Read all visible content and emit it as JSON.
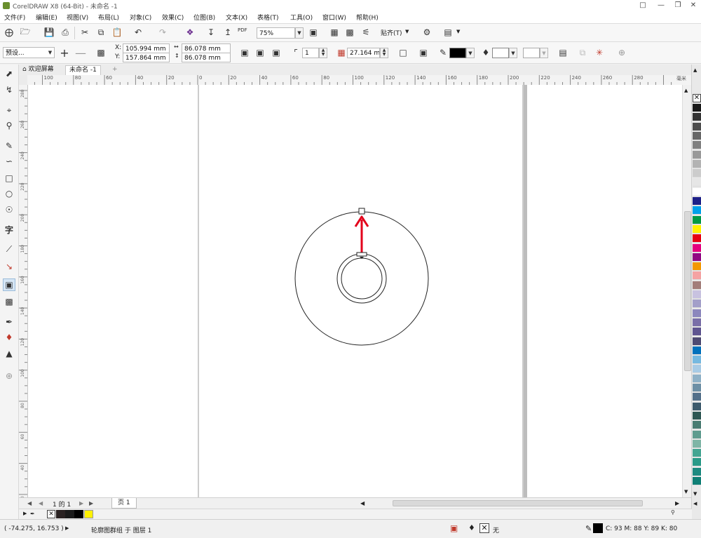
{
  "window": {
    "title": "CorelDRAW X8 (64-Bit) - 未命名 -1"
  },
  "menu": [
    "文件(F)",
    "编辑(E)",
    "视图(V)",
    "布局(L)",
    "对象(C)",
    "效果(C)",
    "位图(B)",
    "文本(X)",
    "表格(T)",
    "工具(O)",
    "窗口(W)",
    "帮助(H)"
  ],
  "standard_toolbar": {
    "zoom_value": "75%",
    "snap_label": "贴齐(T)",
    "pdf_label": "PDF"
  },
  "property_bar": {
    "preset_value": "预设...",
    "x_label": "X:",
    "x_value": "105.994 mm",
    "y_label": "Y:",
    "y_value": "157.864 mm",
    "width_value": "86.078 mm",
    "height_value": "86.078 mm",
    "steps_value": "1",
    "offset_value": "27.164 mm"
  },
  "doc_tabs": {
    "welcome": "欢迎屏幕",
    "active": "未命名 -1"
  },
  "ruler": {
    "h_labels": [
      "100",
      "80",
      "60",
      "40",
      "20",
      "0",
      "20",
      "40",
      "60",
      "80",
      "100",
      "120",
      "140",
      "160",
      "180",
      "200",
      "220",
      "240",
      "260",
      "280"
    ],
    "h_unit": "毫米",
    "v_labels": [
      "280",
      "260",
      "240",
      "220",
      "200",
      "180",
      "160",
      "140",
      "120",
      "100",
      "80",
      "60",
      "40",
      "20"
    ]
  },
  "page_nav": {
    "page_counter": "1 的 1",
    "page_tab": "页 1"
  },
  "status": {
    "cursor_coords": "( -74.275, 16.753 )",
    "selection_info": "轮廓图群组 于 图层 1",
    "fill_label": "无",
    "outline_color": "C: 93 M: 88 Y: 89 K: 80"
  },
  "colors": {
    "accent": "#e3001b",
    "palette": [
      "#1a1a1a",
      "#333333",
      "#4d4d4d",
      "#666666",
      "#808080",
      "#999999",
      "#b3b3b3",
      "#cccccc",
      "#e6e6e6",
      "#ffffff",
      "#1d2088",
      "#00a0e9",
      "#009944",
      "#fff100",
      "#e60012",
      "#e4007f",
      "#920783",
      "#f39800",
      "#f5a3a3",
      "#a37e7a",
      "#c8c2e0",
      "#a39fc9",
      "#8c87bd",
      "#7a6fa8",
      "#5f5590",
      "#4e4a72",
      "#0071bc",
      "#76b9e0",
      "#a8cbe5",
      "#8fb1c7",
      "#6d8fa5",
      "#54708a",
      "#3d5a6c",
      "#2e5753",
      "#4a7c72",
      "#5f9c8f",
      "#7fb5a6",
      "#44a592",
      "#2a9a88",
      "#1d8a80",
      "#0f7f75"
    ]
  }
}
